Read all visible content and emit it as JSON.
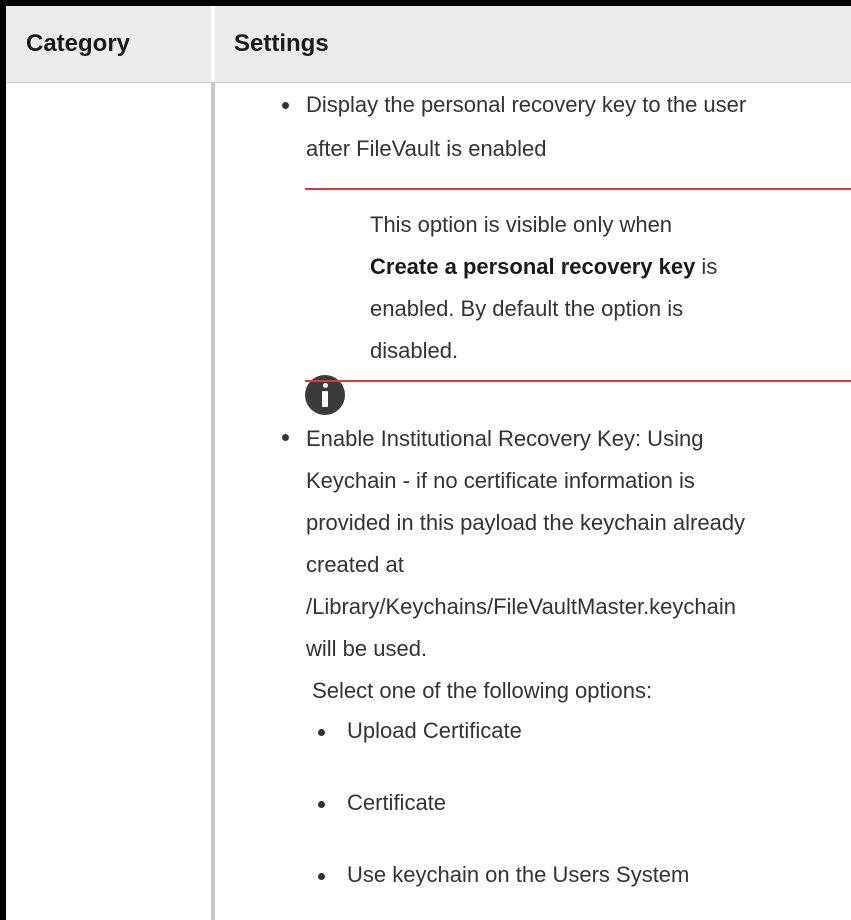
{
  "table": {
    "headers": {
      "category": "Category",
      "settings": "Settings"
    },
    "rows": {
      "item1_line1": "Display the personal recovery key to the user",
      "item1_line2": "after FileVault is enabled",
      "note": {
        "line1": "This option is visible only when",
        "bold": "Create a personal recovery key",
        "after_bold": " is",
        "line3": "enabled. By default the option is",
        "line4": "disabled."
      },
      "item2_lines": [
        "Enable Institutional Recovery Key: Using",
        "Keychain - if no certificate information is",
        "provided in this payload the keychain already",
        "created at",
        "/Library/Keychains/FileVaultMaster.keychain",
        "will be used.",
        " Select one of the following options:"
      ],
      "sub_options": [
        "Upload Certificate",
        "Certificate",
        "Use keychain on the Users System"
      ]
    }
  },
  "icons": {
    "note": "info-icon"
  },
  "colors": {
    "note_rule": "#d63b3b",
    "header_bg": "#ebebeb",
    "column_divider": "#c8c8c8"
  }
}
